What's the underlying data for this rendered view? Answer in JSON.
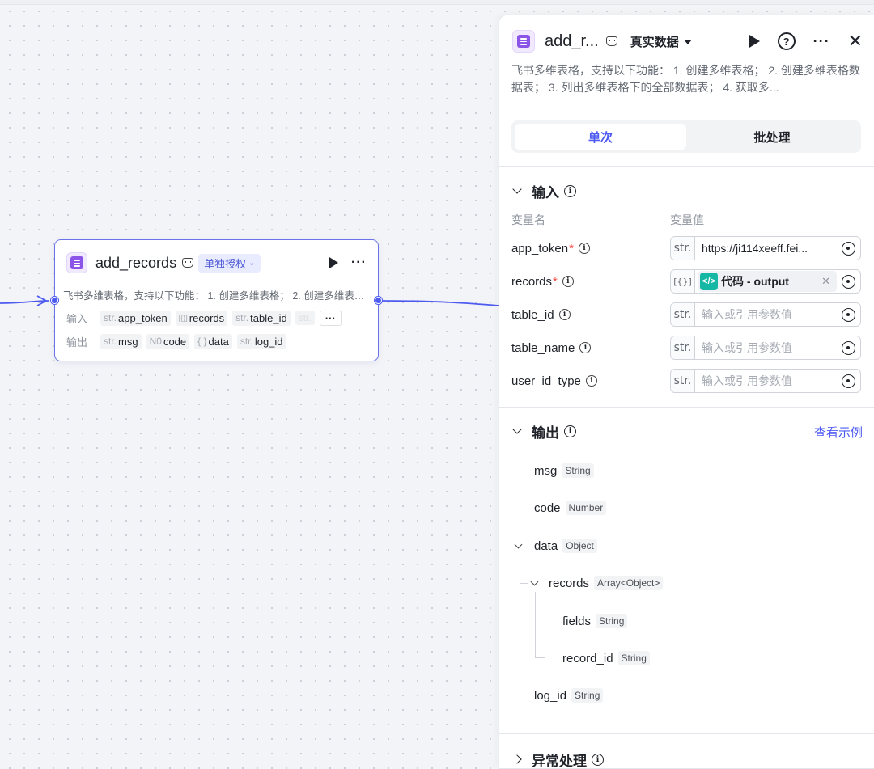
{
  "node": {
    "title": "add_records",
    "auth_badge": "单独授权",
    "description": "飞书多维表格，支持以下功能： 1. 创建多维表格； 2. 创建多维表格数据表； 3. 列出多维表格下的全部数据表； 4. 获取多...",
    "input_label": "输入",
    "output_label": "输出",
    "inputs": [
      {
        "type": "str.",
        "name": "app_token"
      },
      {
        "type": "[{}]",
        "name": "records"
      },
      {
        "type": "str.",
        "name": "table_id"
      },
      {
        "type": "str.",
        "name": ""
      }
    ],
    "more": "···",
    "outputs": [
      {
        "type": "str.",
        "name": "msg"
      },
      {
        "type": "N0",
        "name": "code"
      },
      {
        "type": "{ }",
        "name": "data"
      },
      {
        "type": "str.",
        "name": "log_id"
      }
    ]
  },
  "panel": {
    "title": "add_r...",
    "mode": "真实数据",
    "description": "飞书多维表格，支持以下功能： 1. 创建多维表格； 2. 创建多维表格数据表； 3. 列出多维表格下的全部数据表； 4. 获取多...",
    "tabs": [
      "单次",
      "批处理"
    ],
    "input_section": "输入",
    "col_var_name": "变量名",
    "col_var_value": "变量值",
    "inputs": [
      {
        "name": "app_token",
        "required": "*",
        "type": "str.",
        "value": "https://ji114xeeff.fei..."
      },
      {
        "name": "records",
        "required": "*",
        "type": "[{}]",
        "ref": "代码 - output"
      },
      {
        "name": "table_id",
        "type": "str.",
        "placeholder": "输入或引用参数值"
      },
      {
        "name": "table_name",
        "type": "str.",
        "placeholder": "输入或引用参数值"
      },
      {
        "name": "user_id_type",
        "type": "str.",
        "placeholder": "输入或引用参数值"
      }
    ],
    "output_section": "输出",
    "view_example": "查看示例",
    "outputs": [
      {
        "name": "msg",
        "type": "String"
      },
      {
        "name": "code",
        "type": "Number"
      },
      {
        "name": "data",
        "type": "Object"
      },
      {
        "name": "records",
        "type": "Array<Object>"
      },
      {
        "name": "fields",
        "type": "String"
      },
      {
        "name": "record_id",
        "type": "String"
      },
      {
        "name": "log_id",
        "type": "String"
      }
    ],
    "error_section": "异常处理"
  },
  "icons": {
    "app": "table-app-icon",
    "play": "play-icon",
    "help": "help-icon",
    "more": "more-icon",
    "close": "close-icon"
  },
  "colors": {
    "accent": "#4e5bf0",
    "app_icon": "#8b55e8",
    "code_icon": "#16b7a5",
    "required": "#f54a45"
  }
}
